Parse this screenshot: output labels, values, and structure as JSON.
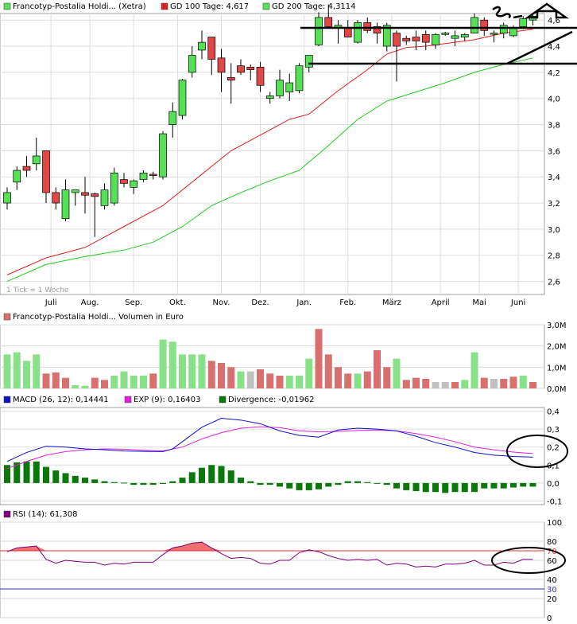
{
  "colors": {
    "bull": "#55e055",
    "bear": "#e04848",
    "gd100": "#e02020",
    "gd200": "#22cc22",
    "vol_up": "#88e088",
    "vol_down": "#d87070",
    "vol_flat": "#c0c0c0",
    "macd": "#1010c8",
    "signal": "#e020e0",
    "divergence": "#0a780a",
    "rsi": "#800080",
    "rsi_fill": "#f07070",
    "rsi_line70": "#e03030",
    "rsi_line30": "#3030d0"
  },
  "price_legend": [
    {
      "label": "Francotyp-Postalia Holdi... (Xetra)",
      "color": "#55e055"
    },
    {
      "label": "GD 100 Tage: 4,617",
      "color": "#e02020"
    },
    {
      "label": "GD 200 Tage: 4,3114",
      "color": "#22cc22"
    }
  ],
  "note": "1 Tick = 1 Woche",
  "volume_legend": "Francotyp-Postalia Holdi... Volumen in Euro",
  "macd_legend": [
    {
      "label": "MACD (26, 12): 0,14441",
      "color": "#1010c8"
    },
    {
      "label": "EXP (9): 0,16403",
      "color": "#e020e0"
    },
    {
      "label": "Divergence: -0,01962",
      "color": "#0a780a"
    }
  ],
  "rsi_legend": {
    "label": "RSI (14): 61,308",
    "color": "#800080"
  },
  "chart_data": [
    {
      "type": "candlestick",
      "title": "Francotyp-Postalia Holdi... (Xetra)",
      "x_labels": [
        "Juli",
        "Aug.",
        "Sep.",
        "Okt.",
        "Nov.",
        "Dez.",
        "Jan.",
        "Feb.",
        "März",
        "April",
        "Mai",
        "Juni"
      ],
      "x_label_weeks": [
        4.5,
        8.5,
        13,
        17.5,
        22,
        26,
        30.5,
        35,
        39.5,
        44.5,
        48.5,
        52.5
      ],
      "ylim": [
        2.5,
        4.65
      ],
      "y_ticks": [
        "2,6",
        "2,8",
        "3,0",
        "3,2",
        "3,4",
        "3,6",
        "3,8",
        "4,0",
        "4,2",
        "4,4",
        "4,6"
      ],
      "y_tick_values": [
        2.6,
        2.8,
        3.0,
        3.2,
        3.4,
        3.6,
        3.8,
        4.0,
        4.2,
        4.4,
        4.6
      ],
      "candles": [
        {
          "o": 3.2,
          "h": 3.32,
          "l": 3.15,
          "c": 3.28
        },
        {
          "o": 3.36,
          "h": 3.48,
          "l": 3.3,
          "c": 3.45
        },
        {
          "o": 3.48,
          "h": 3.56,
          "l": 3.4,
          "c": 3.45
        },
        {
          "o": 3.5,
          "h": 3.7,
          "l": 3.45,
          "c": 3.56
        },
        {
          "o": 3.6,
          "h": 3.6,
          "l": 3.2,
          "c": 3.28
        },
        {
          "o": 3.28,
          "h": 3.32,
          "l": 3.15,
          "c": 3.2
        },
        {
          "o": 3.08,
          "h": 3.38,
          "l": 3.06,
          "c": 3.3
        },
        {
          "o": 3.28,
          "h": 3.3,
          "l": 3.18,
          "c": 3.3
        },
        {
          "o": 3.28,
          "h": 3.4,
          "l": 3.12,
          "c": 3.26
        },
        {
          "o": 3.27,
          "h": 3.28,
          "l": 2.94,
          "c": 3.25
        },
        {
          "o": 3.18,
          "h": 3.35,
          "l": 3.15,
          "c": 3.3
        },
        {
          "o": 3.2,
          "h": 3.47,
          "l": 3.18,
          "c": 3.43
        },
        {
          "o": 3.38,
          "h": 3.43,
          "l": 3.32,
          "c": 3.35
        },
        {
          "o": 3.32,
          "h": 3.38,
          "l": 3.27,
          "c": 3.37
        },
        {
          "o": 3.38,
          "h": 3.45,
          "l": 3.36,
          "c": 3.43
        },
        {
          "o": 3.42,
          "h": 3.44,
          "l": 3.38,
          "c": 3.41
        },
        {
          "o": 3.4,
          "h": 3.75,
          "l": 3.38,
          "c": 3.73
        },
        {
          "o": 3.8,
          "h": 3.97,
          "l": 3.7,
          "c": 3.9
        },
        {
          "o": 3.87,
          "h": 4.15,
          "l": 3.84,
          "c": 4.14
        },
        {
          "o": 4.2,
          "h": 4.4,
          "l": 4.16,
          "c": 4.33
        },
        {
          "o": 4.37,
          "h": 4.52,
          "l": 4.3,
          "c": 4.43
        },
        {
          "o": 4.47,
          "h": 4.47,
          "l": 4.18,
          "c": 4.3
        },
        {
          "o": 4.31,
          "h": 4.38,
          "l": 4.05,
          "c": 4.2
        },
        {
          "o": 4.16,
          "h": 4.27,
          "l": 3.96,
          "c": 4.14
        },
        {
          "o": 4.25,
          "h": 4.3,
          "l": 4.18,
          "c": 4.2
        },
        {
          "o": 4.24,
          "h": 4.26,
          "l": 4.14,
          "c": 4.22
        },
        {
          "o": 4.24,
          "h": 4.28,
          "l": 4.05,
          "c": 4.1
        },
        {
          "o": 4.0,
          "h": 4.05,
          "l": 3.96,
          "c": 4.02
        },
        {
          "o": 4.02,
          "h": 4.22,
          "l": 4.0,
          "c": 4.14
        },
        {
          "o": 4.05,
          "h": 4.19,
          "l": 3.98,
          "c": 4.12
        },
        {
          "o": 4.06,
          "h": 4.27,
          "l": 4.04,
          "c": 4.25
        },
        {
          "o": 4.24,
          "h": 4.32,
          "l": 4.2,
          "c": 4.33
        },
        {
          "o": 4.41,
          "h": 4.66,
          "l": 4.4,
          "c": 4.62
        },
        {
          "o": 4.62,
          "h": 4.72,
          "l": 4.55,
          "c": 4.55
        },
        {
          "o": 4.54,
          "h": 4.6,
          "l": 4.42,
          "c": 4.56
        },
        {
          "o": 4.54,
          "h": 4.6,
          "l": 4.48,
          "c": 4.47
        },
        {
          "o": 4.43,
          "h": 4.6,
          "l": 4.42,
          "c": 4.58
        },
        {
          "o": 4.58,
          "h": 4.62,
          "l": 4.5,
          "c": 4.52
        },
        {
          "o": 4.55,
          "h": 4.58,
          "l": 4.42,
          "c": 4.5
        },
        {
          "o": 4.4,
          "h": 4.58,
          "l": 4.36,
          "c": 4.56
        },
        {
          "o": 4.5,
          "h": 4.52,
          "l": 4.13,
          "c": 4.4
        },
        {
          "o": 4.46,
          "h": 4.48,
          "l": 4.41,
          "c": 4.44
        },
        {
          "o": 4.47,
          "h": 4.52,
          "l": 4.37,
          "c": 4.44
        },
        {
          "o": 4.49,
          "h": 4.52,
          "l": 4.37,
          "c": 4.43
        },
        {
          "o": 4.41,
          "h": 4.5,
          "l": 4.38,
          "c": 4.49
        },
        {
          "o": 4.49,
          "h": 4.51,
          "l": 4.48,
          "c": 4.5
        },
        {
          "o": 4.46,
          "h": 4.52,
          "l": 4.4,
          "c": 4.48
        },
        {
          "o": 4.47,
          "h": 4.5,
          "l": 4.44,
          "c": 4.49
        },
        {
          "o": 4.5,
          "h": 4.65,
          "l": 4.5,
          "c": 4.62
        },
        {
          "o": 4.6,
          "h": 4.62,
          "l": 4.48,
          "c": 4.52
        },
        {
          "o": 4.5,
          "h": 4.52,
          "l": 4.43,
          "c": 4.5
        },
        {
          "o": 4.5,
          "h": 4.58,
          "l": 4.46,
          "c": 4.56
        },
        {
          "o": 4.48,
          "h": 4.56,
          "l": 4.47,
          "c": 4.54
        },
        {
          "o": 4.55,
          "h": 4.63,
          "l": 4.53,
          "c": 4.61
        },
        {
          "o": 4.6,
          "h": 4.64,
          "l": 4.56,
          "c": 4.63
        }
      ],
      "gd100": [
        [
          0,
          2.65
        ],
        [
          4,
          2.78
        ],
        [
          8,
          2.86
        ],
        [
          12,
          3.02
        ],
        [
          16,
          3.18
        ],
        [
          20,
          3.42
        ],
        [
          23,
          3.6
        ],
        [
          26,
          3.72
        ],
        [
          29,
          3.84
        ],
        [
          31,
          3.88
        ],
        [
          34,
          4.06
        ],
        [
          37,
          4.22
        ],
        [
          39,
          4.34
        ],
        [
          41,
          4.39
        ],
        [
          43,
          4.4
        ],
        [
          45,
          4.42
        ],
        [
          48,
          4.45
        ],
        [
          51,
          4.5
        ],
        [
          54,
          4.53
        ]
      ],
      "gd200": [
        [
          0,
          2.6
        ],
        [
          4,
          2.73
        ],
        [
          8,
          2.79
        ],
        [
          12,
          2.84
        ],
        [
          15,
          2.9
        ],
        [
          18,
          3.02
        ],
        [
          21,
          3.18
        ],
        [
          24,
          3.28
        ],
        [
          27,
          3.37
        ],
        [
          30,
          3.45
        ],
        [
          33,
          3.64
        ],
        [
          36,
          3.84
        ],
        [
          39,
          3.98
        ],
        [
          42,
          4.05
        ],
        [
          45,
          4.12
        ],
        [
          48,
          4.2
        ],
        [
          51,
          4.26
        ],
        [
          54,
          4.31
        ]
      ]
    },
    {
      "type": "bar",
      "title": "Francotyp-Postalia Holdi... Volumen in Euro",
      "ylim": [
        0,
        3.0
      ],
      "y_ticks": [
        "0,0M",
        "1,0M",
        "2,0M",
        "3,0M"
      ],
      "y_tick_values": [
        0,
        1.0,
        2.0,
        3.0
      ],
      "values": [
        1.6,
        1.7,
        1.3,
        1.6,
        0.7,
        0.75,
        0.5,
        0.15,
        0.12,
        0.5,
        0.4,
        0.6,
        0.8,
        0.6,
        0.6,
        0.7,
        2.3,
        2.2,
        1.6,
        1.6,
        1.6,
        1.3,
        1.2,
        1.0,
        0.8,
        0.8,
        0.9,
        0.7,
        0.6,
        0.6,
        0.6,
        1.4,
        2.8,
        1.6,
        1.0,
        0.7,
        0.7,
        0.8,
        1.8,
        1.0,
        1.4,
        0.4,
        0.5,
        0.45,
        0.3,
        0.3,
        0.3,
        0.4,
        1.7,
        0.5,
        0.45,
        0.45,
        0.55,
        0.6,
        0.3
      ],
      "direction": [
        "u",
        "u",
        "u",
        "u",
        "d",
        "d",
        "d",
        "u",
        "u",
        "d",
        "d",
        "u",
        "u",
        "u",
        "u",
        "d",
        "u",
        "u",
        "u",
        "u",
        "u",
        "d",
        "d",
        "d",
        "u",
        "f",
        "d",
        "d",
        "d",
        "u",
        "u",
        "u",
        "d",
        "d",
        "d",
        "d",
        "u",
        "d",
        "d",
        "d",
        "u",
        "d",
        "d",
        "d",
        "f",
        "f",
        "d",
        "u",
        "u",
        "d",
        "f",
        "d",
        "d",
        "u",
        "d"
      ]
    },
    {
      "type": "line",
      "title": "MACD",
      "ylim": [
        -0.12,
        0.42
      ],
      "y_ticks": [
        "-0,1",
        "0,0",
        "0,1",
        "0,2",
        "0,3",
        "0,4"
      ],
      "y_tick_values": [
        -0.1,
        0,
        0.1,
        0.2,
        0.3,
        0.4
      ],
      "series": [
        {
          "name": "MACD (26, 12): 0,14441",
          "values": [
            [
              0,
              0.12
            ],
            [
              2,
              0.17
            ],
            [
              4,
              0.205
            ],
            [
              6,
              0.2
            ],
            [
              8,
              0.19
            ],
            [
              10,
              0.185
            ],
            [
              12,
              0.178
            ],
            [
              14,
              0.176
            ],
            [
              16,
              0.175
            ],
            [
              17,
              0.19
            ],
            [
              18,
              0.23
            ],
            [
              20,
              0.31
            ],
            [
              22,
              0.36
            ],
            [
              24,
              0.35
            ],
            [
              26,
              0.33
            ],
            [
              28,
              0.29
            ],
            [
              30,
              0.265
            ],
            [
              32,
              0.255
            ],
            [
              34,
              0.295
            ],
            [
              36,
              0.305
            ],
            [
              38,
              0.3
            ],
            [
              40,
              0.29
            ],
            [
              42,
              0.26
            ],
            [
              44,
              0.225
            ],
            [
              46,
              0.2
            ],
            [
              48,
              0.17
            ],
            [
              50,
              0.155
            ],
            [
              52,
              0.148
            ],
            [
              54,
              0.144
            ]
          ]
        },
        {
          "name": "EXP (9): 0,16403",
          "values": [
            [
              0,
              0.08
            ],
            [
              2,
              0.12
            ],
            [
              4,
              0.155
            ],
            [
              6,
              0.175
            ],
            [
              8,
              0.185
            ],
            [
              10,
              0.19
            ],
            [
              12,
              0.188
            ],
            [
              14,
              0.182
            ],
            [
              16,
              0.178
            ],
            [
              18,
              0.2
            ],
            [
              20,
              0.245
            ],
            [
              22,
              0.28
            ],
            [
              24,
              0.305
            ],
            [
              26,
              0.313
            ],
            [
              28,
              0.308
            ],
            [
              30,
              0.29
            ],
            [
              32,
              0.285
            ],
            [
              34,
              0.287
            ],
            [
              36,
              0.292
            ],
            [
              38,
              0.295
            ],
            [
              40,
              0.29
            ],
            [
              42,
              0.275
            ],
            [
              44,
              0.255
            ],
            [
              46,
              0.23
            ],
            [
              48,
              0.2
            ],
            [
              50,
              0.185
            ],
            [
              52,
              0.172
            ],
            [
              54,
              0.164
            ]
          ]
        }
      ],
      "divergence": [
        0.1,
        0.115,
        0.12,
        0.12,
        0.09,
        0.07,
        0.055,
        0.04,
        0.03,
        0.02,
        0.01,
        0.005,
        0.002,
        -0.01,
        -0.01,
        -0.01,
        -0.005,
        0.01,
        0.03,
        0.06,
        0.085,
        0.1,
        0.095,
        0.07,
        0.03,
        0.01,
        -0.01,
        -0.01,
        -0.02,
        -0.03,
        -0.04,
        -0.04,
        -0.035,
        -0.02,
        -0.01,
        0.01,
        0.01,
        0.005,
        0.0,
        -0.01,
        -0.03,
        -0.04,
        -0.045,
        -0.05,
        -0.05,
        -0.055,
        -0.05,
        -0.05,
        -0.05,
        -0.03,
        -0.03,
        -0.03,
        -0.025,
        -0.02,
        -0.02
      ]
    },
    {
      "type": "area",
      "title": "RSI (14): 61,308",
      "ylim": [
        0,
        100
      ],
      "y_ticks": [
        "0",
        "20",
        "30",
        "40",
        "60",
        "70",
        "80",
        "100"
      ],
      "y_tick_values": [
        0,
        20,
        30,
        40,
        60,
        70,
        80,
        100
      ],
      "reference_lines": [
        70,
        30
      ],
      "values": [
        69,
        73,
        74,
        75,
        61,
        57,
        60,
        59,
        58,
        58,
        55,
        57,
        56,
        58,
        58,
        58,
        66,
        73,
        75,
        78,
        79,
        73,
        67,
        62,
        63,
        62,
        57,
        56,
        60,
        60,
        68,
        71,
        69,
        65,
        62,
        60,
        61,
        60,
        61,
        55,
        57,
        56,
        53,
        54,
        53,
        56,
        56,
        57,
        60,
        55,
        55,
        58,
        57,
        61,
        61
      ]
    }
  ]
}
